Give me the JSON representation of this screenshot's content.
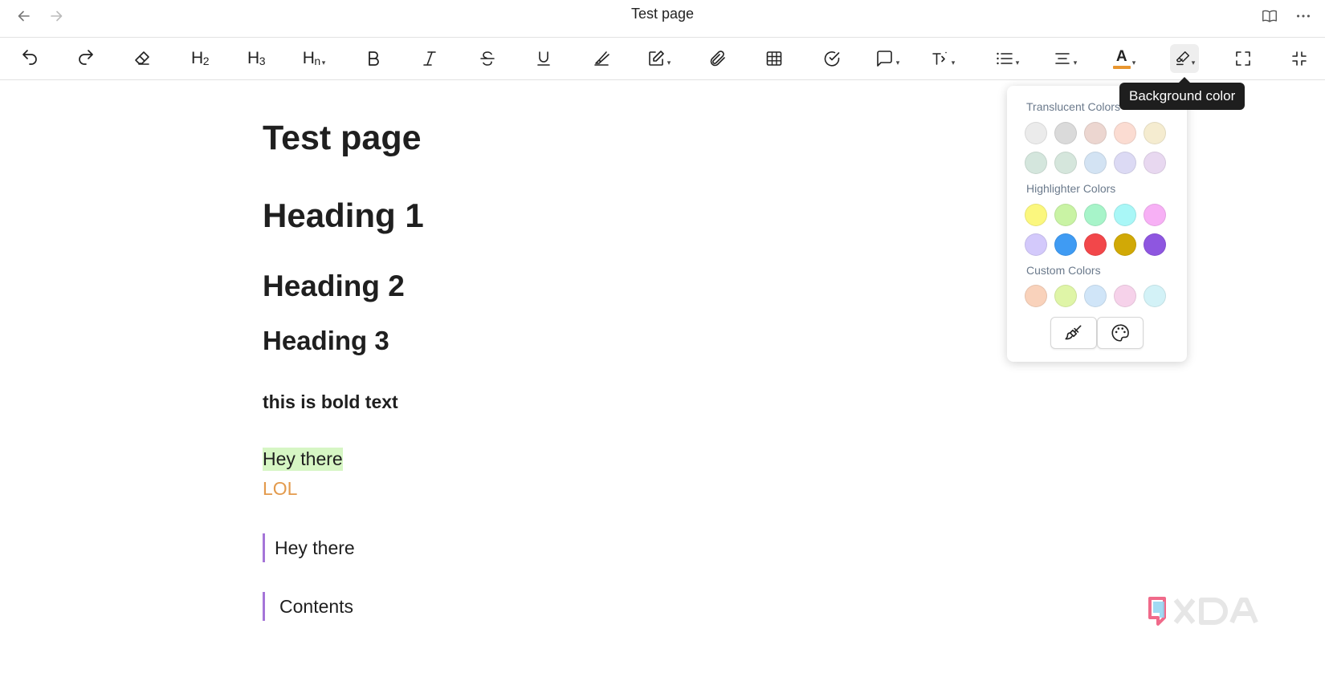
{
  "window": {
    "title": "Test page"
  },
  "toolbar": {
    "h2_label": "H",
    "h2_sub": "2",
    "h3_label": "H",
    "h3_sub": "3",
    "hn_label": "H",
    "hn_sub": "n",
    "font_color_letter": "A",
    "font_color_underline": "#e8962f",
    "active_tool": "background-color"
  },
  "tooltip": {
    "text": "Background color"
  },
  "color_popup": {
    "translucent_label": "Translucent Colors",
    "highlighter_label": "Highlighter Colors",
    "custom_label": "Custom Colors",
    "translucent_colors": [
      [
        "#ebebeb",
        "#dadada",
        "#ecd6d0",
        "#fbdcd2",
        "#f5ecd0"
      ],
      [
        "#d4e6dd",
        "#d5e6dc",
        "#d3e3f3",
        "#dcdaf4",
        "#e8d8f0"
      ]
    ],
    "highlighter_colors": [
      [
        "#fbf77e",
        "#c9f3a4",
        "#a7f4c9",
        "#a9f7f7",
        "#f7b0f5"
      ],
      [
        "#d3c9fb",
        "#3f9bf3",
        "#f2474a",
        "#d1a906",
        "#8e56e0"
      ]
    ],
    "custom_colors": [
      "#f9d2bb",
      "#dff5a7",
      "#d0e5f8",
      "#f6d2ea",
      "#d3f2f7"
    ]
  },
  "document": {
    "title": "Test page",
    "heading1": "Heading 1",
    "heading2": "Heading 2",
    "heading3": "Heading 3",
    "bold_text": "this is bold text",
    "highlighted_text": "Hey there",
    "highlight_color": "#d6f6c4",
    "colored_text": "LOL",
    "colored_text_color": "#e39a4c",
    "quote1": "Hey there",
    "quote2": "Contents",
    "quote_border_color": "#a575d8"
  },
  "watermark": {
    "text": "XDA"
  }
}
